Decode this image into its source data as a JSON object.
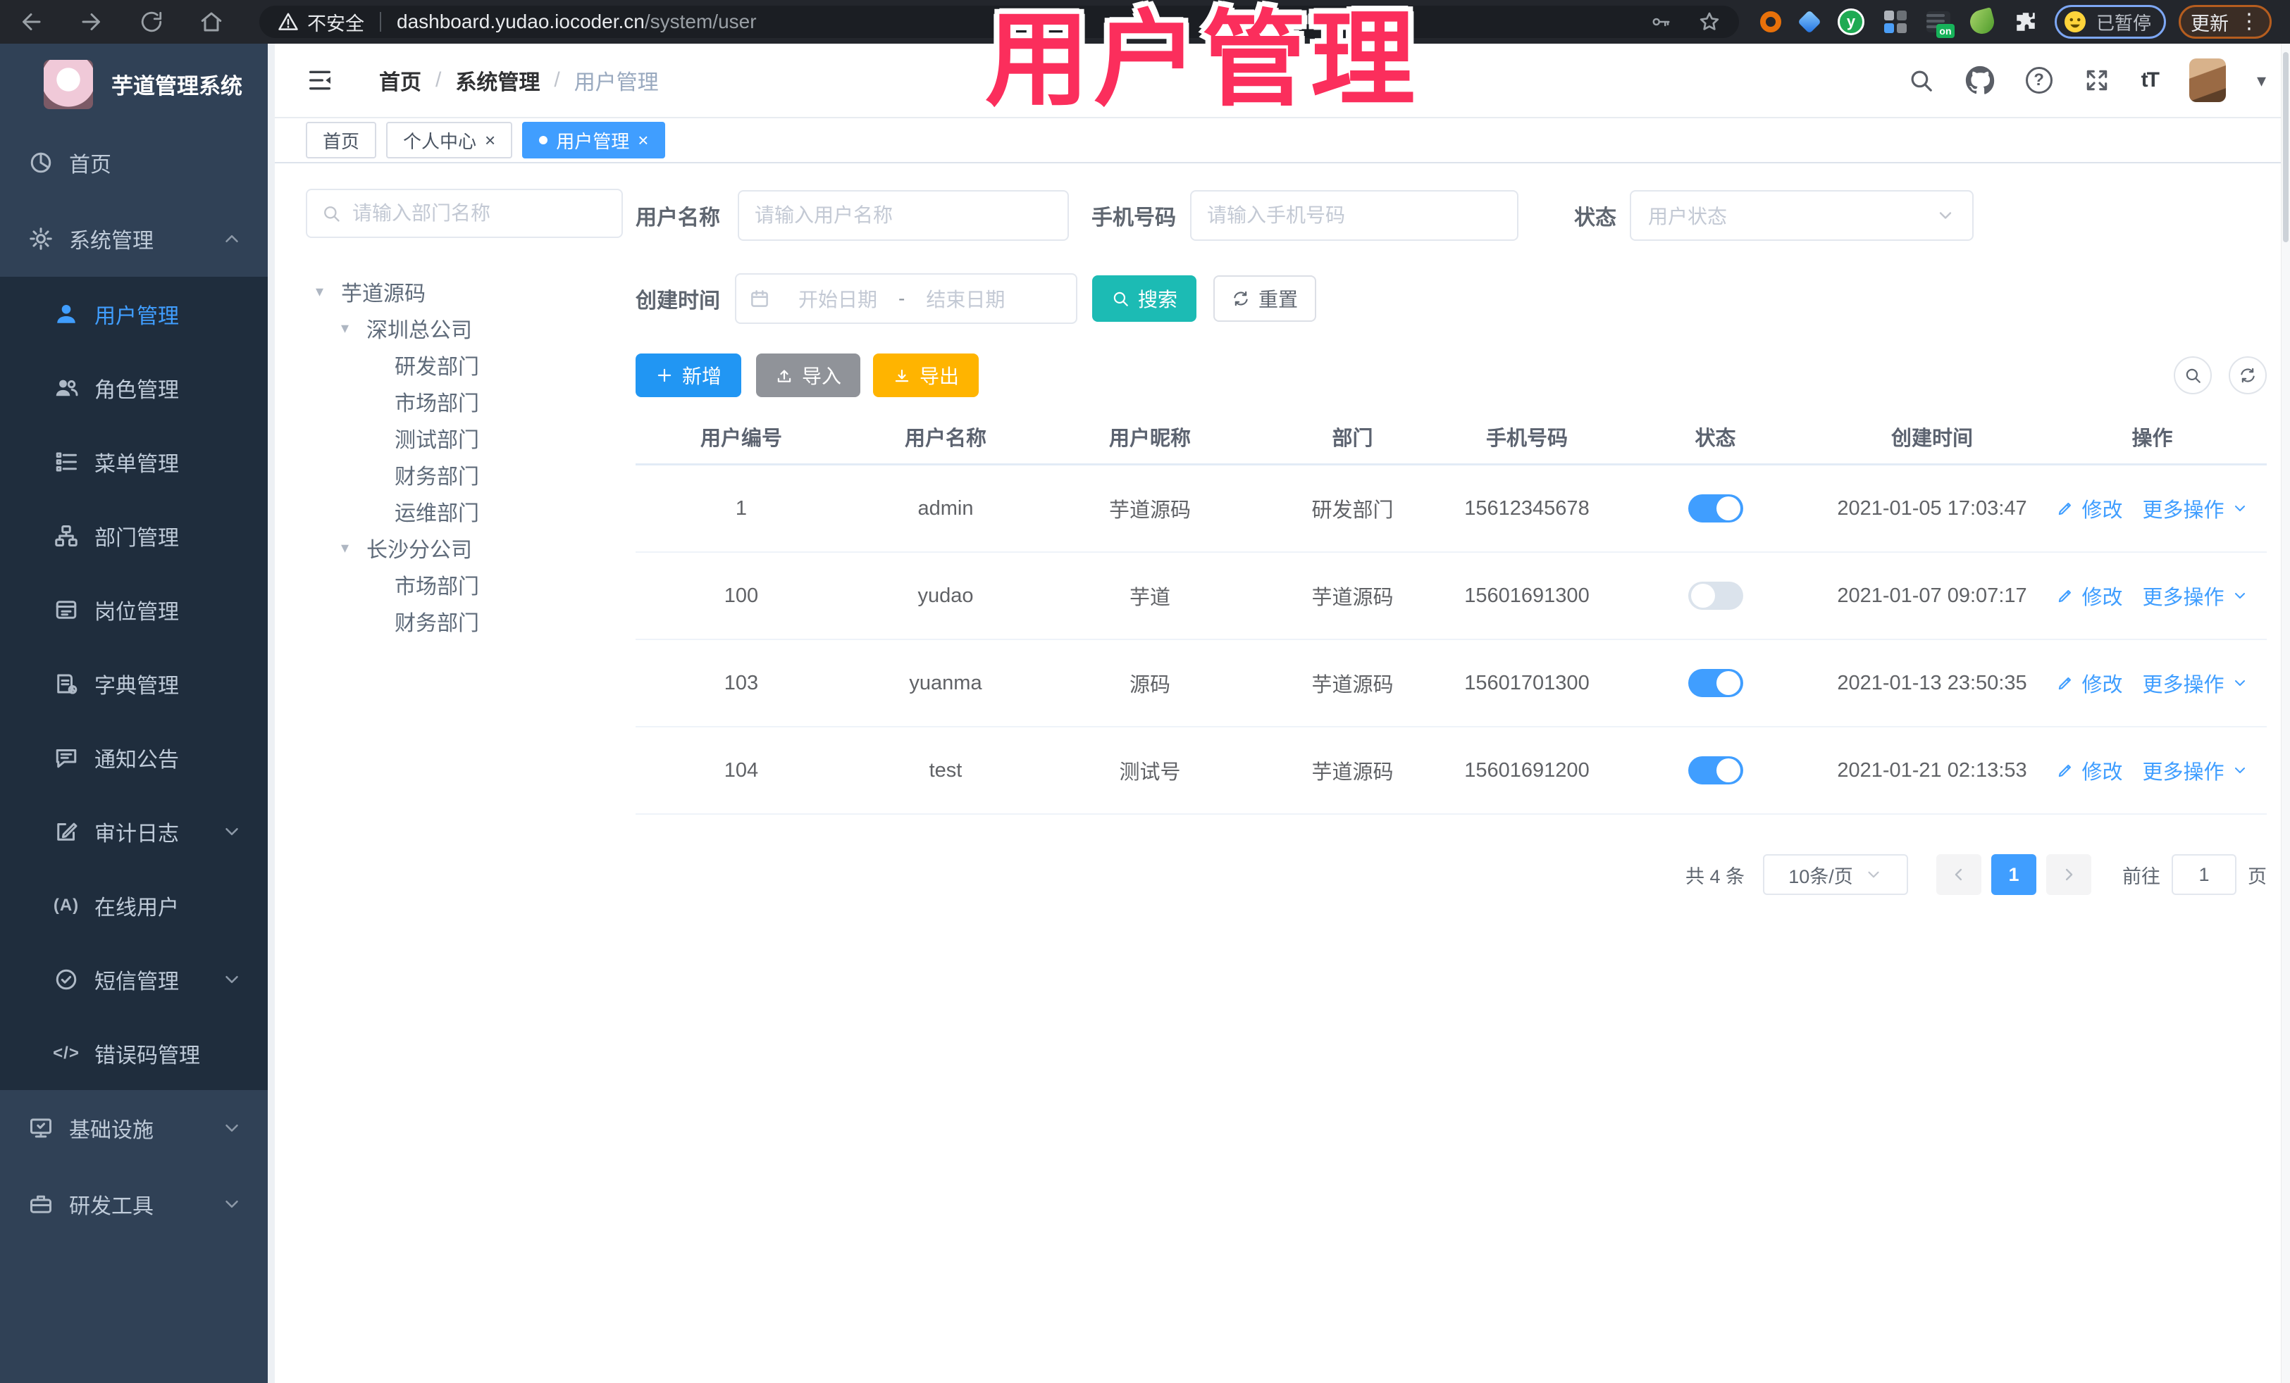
{
  "browser": {
    "security": "不安全",
    "url_host": "dashboard.yudao.iocoder.cn",
    "url_path": "/system/user",
    "paused_badge": "已暂停",
    "update_label": "更新"
  },
  "overlay_title": "用户管理",
  "icons": {
    "close": "×",
    "dots": "⋮",
    "question": "?",
    "font_size": "tT",
    "online": "(A)",
    "code": "</>",
    "tree_caret": "▾",
    "nav_caret": "▾",
    "green_y": "y",
    "on_badge": "on"
  },
  "sidebar": {
    "app_title": "芋道管理系统",
    "items": [
      {
        "label": "首页"
      },
      {
        "label": "系统管理"
      },
      {
        "label": "用户管理"
      },
      {
        "label": "角色管理"
      },
      {
        "label": "菜单管理"
      },
      {
        "label": "部门管理"
      },
      {
        "label": "岗位管理"
      },
      {
        "label": "字典管理"
      },
      {
        "label": "通知公告"
      },
      {
        "label": "审计日志"
      },
      {
        "label": "在线用户"
      },
      {
        "label": "短信管理"
      },
      {
        "label": "错误码管理"
      },
      {
        "label": "基础设施"
      },
      {
        "label": "研发工具"
      }
    ]
  },
  "breadcrumb": {
    "items": [
      "首页",
      "系统管理",
      "用户管理"
    ]
  },
  "tabs": [
    {
      "label": "首页"
    },
    {
      "label": "个人中心"
    },
    {
      "label": "用户管理"
    }
  ],
  "dept_tree": {
    "search_placeholder": "请输入部门名称",
    "nodes": [
      "芋道源码",
      "深圳总公司",
      "研发部门",
      "市场部门",
      "测试部门",
      "财务部门",
      "运维部门",
      "长沙分公司",
      "市场部门",
      "财务部门"
    ]
  },
  "filters": {
    "username_label": "用户名称",
    "username_placeholder": "请输入用户名称",
    "mobile_label": "手机号码",
    "mobile_placeholder": "请输入手机号码",
    "status_label": "状态",
    "status_placeholder": "用户状态",
    "create_time_label": "创建时间",
    "date_start_placeholder": "开始日期",
    "date_separator": "-",
    "date_end_placeholder": "结束日期",
    "search_label": "搜索",
    "reset_label": "重置"
  },
  "toolbar": {
    "add_label": "新增",
    "import_label": "导入",
    "export_label": "导出"
  },
  "table": {
    "columns": [
      "用户编号",
      "用户名称",
      "用户昵称",
      "部门",
      "手机号码",
      "状态",
      "创建时间",
      "操作"
    ],
    "modify_label": "修改",
    "more_label": "更多操作",
    "rows": [
      {
        "id": "1",
        "username": "admin",
        "nickname": "芋道源码",
        "dept": "研发部门",
        "mobile": "15612345678",
        "status": true,
        "created": "2021-01-05 17:03:47"
      },
      {
        "id": "100",
        "username": "yudao",
        "nickname": "芋道",
        "dept": "芋道源码",
        "mobile": "15601691300",
        "status": false,
        "created": "2021-01-07 09:07:17"
      },
      {
        "id": "103",
        "username": "yuanma",
        "nickname": "源码",
        "dept": "芋道源码",
        "mobile": "15601701300",
        "status": true,
        "created": "2021-01-13 23:50:35"
      },
      {
        "id": "104",
        "username": "test",
        "nickname": "测试号",
        "dept": "芋道源码",
        "mobile": "15601691200",
        "status": true,
        "created": "2021-01-21 02:13:53"
      }
    ]
  },
  "pagination": {
    "total": "共 4 条",
    "page_size": "10条/页",
    "current_page": "1",
    "goto_label": "前往",
    "goto_value": "1",
    "page_unit": "页"
  },
  "colors": {
    "accent": "#409eff",
    "search_button": "#1cbbb4",
    "export_button": "#ffb400",
    "overlay_text": "#fb2e5c",
    "sidebar_bg": "#304156",
    "submenu_bg": "#1f2d3d"
  }
}
